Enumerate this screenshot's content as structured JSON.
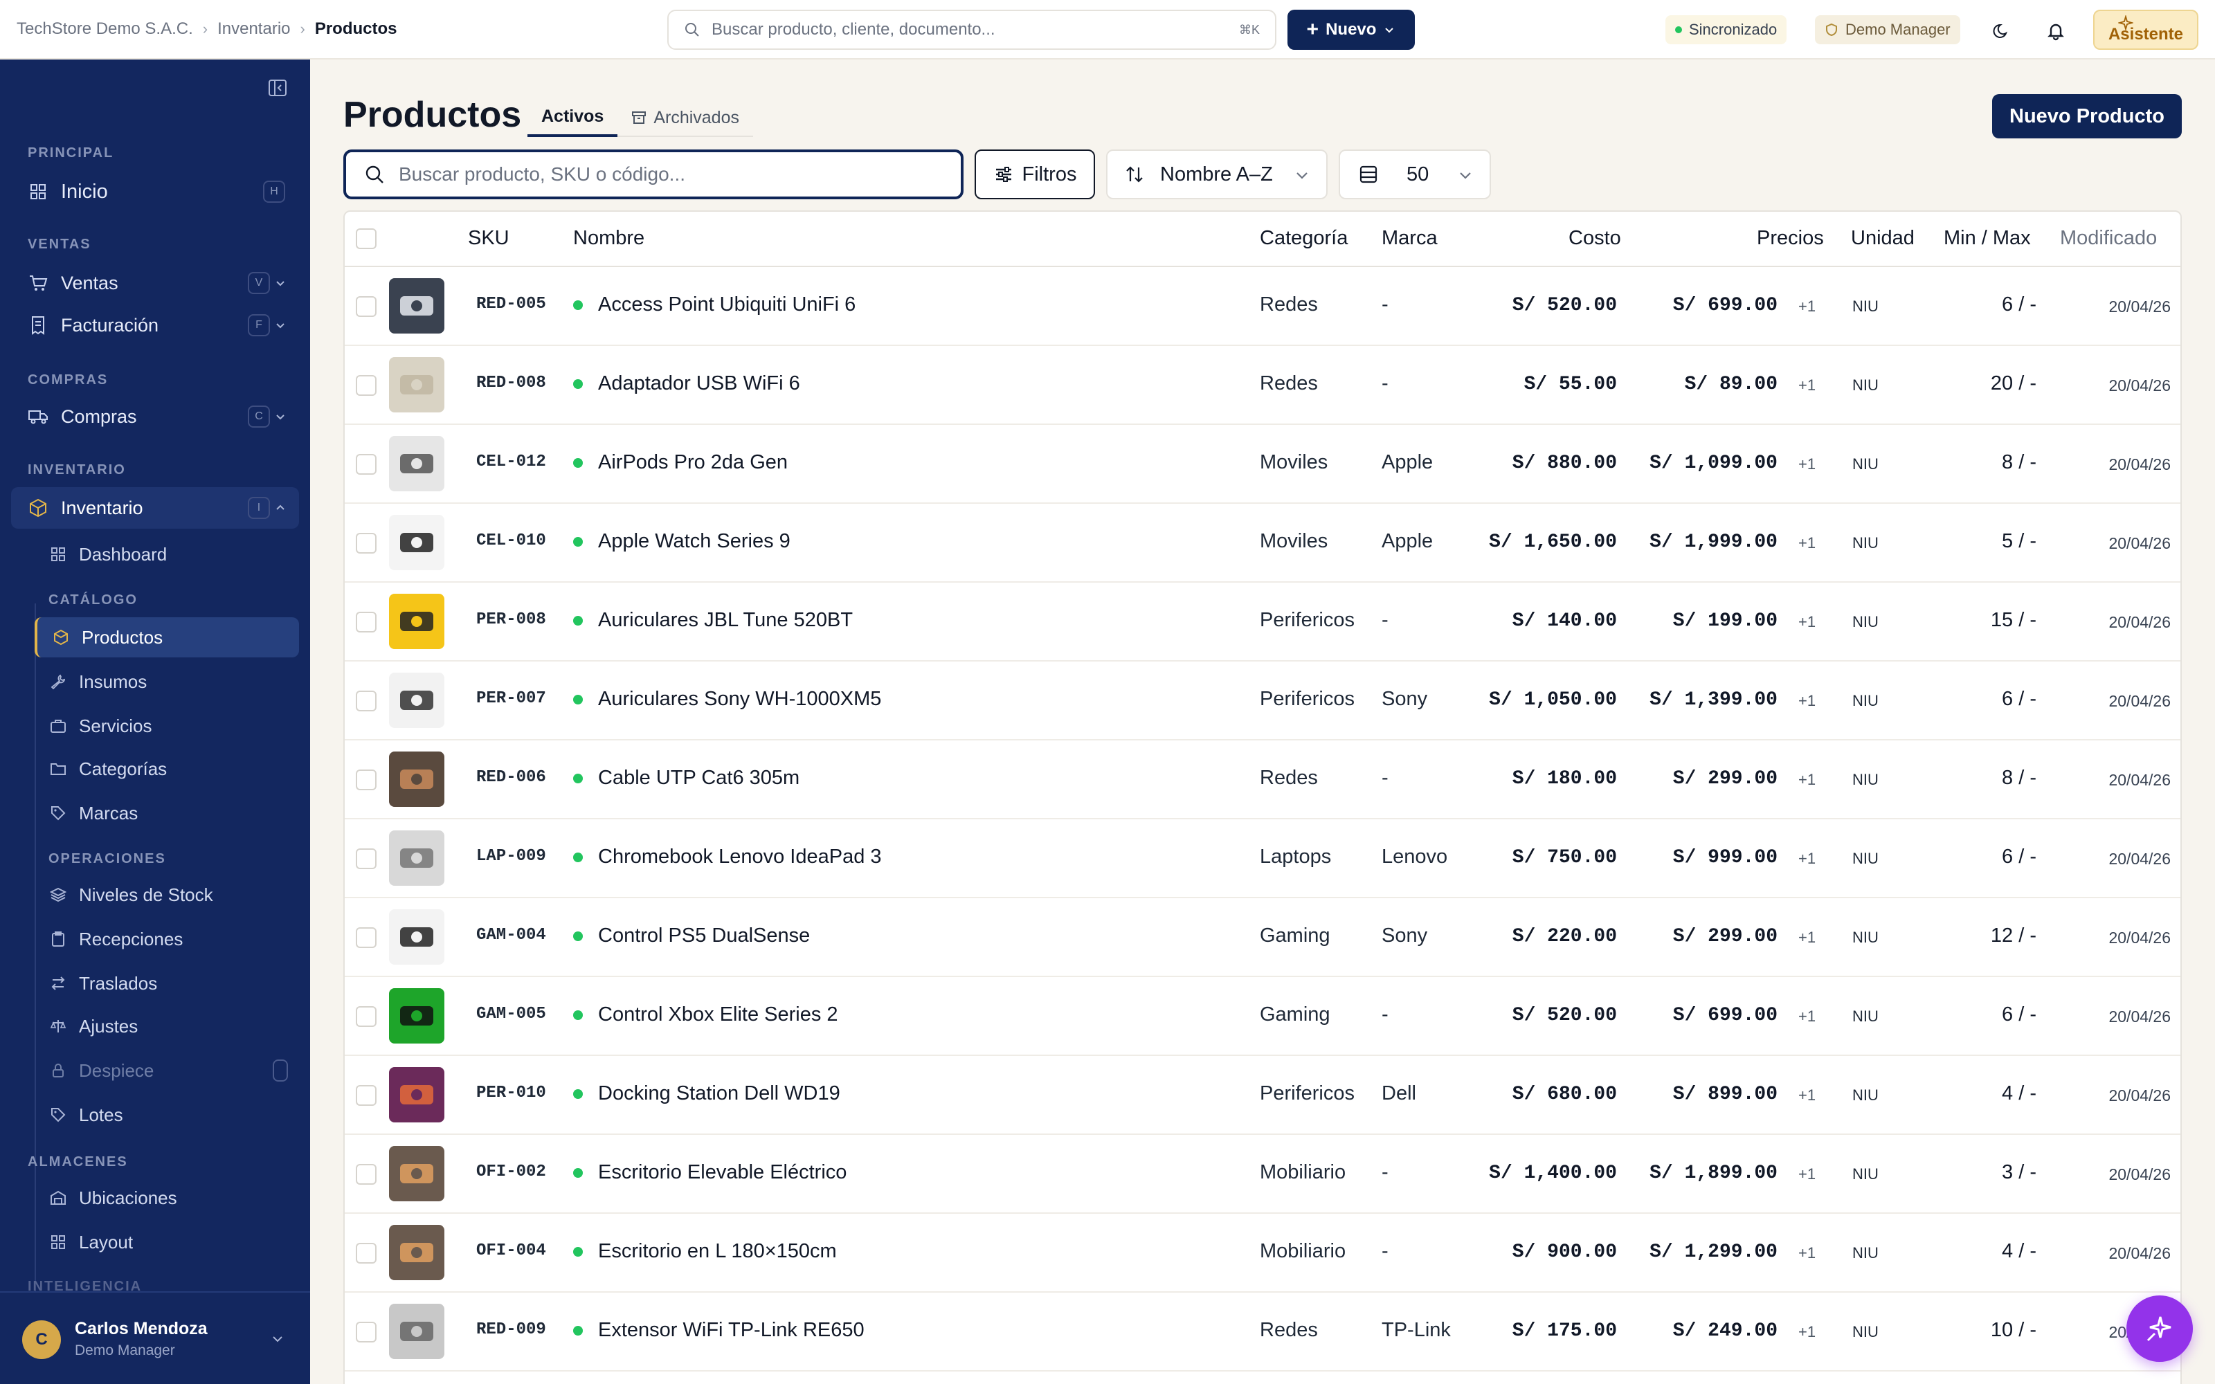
{
  "topbar": {
    "breadcrumb": [
      "TechStore Demo S.A.C.",
      "Inventario",
      "Productos"
    ],
    "search_placeholder": "Buscar producto, cliente, documento...",
    "search_shortcut": "⌘K",
    "new_label": "Nuevo",
    "sync_label": "Sincronizado",
    "role_label": "Demo Manager",
    "assistant_label": "Asistente"
  },
  "sidebar": {
    "sections": {
      "principal": "PRINCIPAL",
      "ventas": "VENTAS",
      "compras": "COMPRAS",
      "inventario": "INVENTARIO",
      "almacenes": "ALMACENES",
      "inteligencia": "INTELIGENCIA"
    },
    "items": {
      "inicio": {
        "label": "Inicio",
        "key": "H"
      },
      "ventas": {
        "label": "Ventas",
        "key": "V"
      },
      "facturacion": {
        "label": "Facturación",
        "key": "F"
      },
      "compras": {
        "label": "Compras",
        "key": "C"
      },
      "inventario": {
        "label": "Inventario",
        "key": "I"
      }
    },
    "subsections": {
      "catalogo": "CATÁLOGO",
      "operaciones": "OPERACIONES"
    },
    "sub": {
      "dashboard": "Dashboard",
      "productos": "Productos",
      "insumos": "Insumos",
      "servicios": "Servicios",
      "categorias": "Categorías",
      "marcas": "Marcas",
      "niveles": "Niveles de Stock",
      "recepciones": "Recepciones",
      "traslados": "Traslados",
      "ajustes": "Ajustes",
      "despiece": "Despiece",
      "lotes": "Lotes",
      "ubicaciones": "Ubicaciones",
      "layout": "Layout"
    },
    "user": {
      "initial": "C",
      "name": "Carlos Mendoza",
      "role": "Demo Manager"
    }
  },
  "main": {
    "title": "Productos",
    "tabs": [
      "Activos",
      "Archivados"
    ],
    "new_product_label": "Nuevo Producto",
    "search_placeholder": "Buscar producto, SKU o código...",
    "filter_label": "Filtros",
    "sort_value": "Nombre A–Z",
    "page_size": "50",
    "columns": {
      "sku": "SKU",
      "name": "Nombre",
      "category": "Categoría",
      "brand": "Marca",
      "cost": "Costo",
      "prices": "Precios",
      "unit": "Unidad",
      "minmax": "Min / Max",
      "modified": "Modificado"
    }
  },
  "rows": [
    {
      "sku": "RED-005",
      "name": "Access Point Ubiquiti UniFi 6",
      "category": "Redes",
      "brand": "-",
      "cost": "S/ 520.00",
      "price": "S/ 699.00",
      "extra": "+1",
      "unit": "NIU",
      "minmax": "6 / -",
      "modified": "20/04/26"
    },
    {
      "sku": "RED-008",
      "name": "Adaptador USB WiFi 6",
      "category": "Redes",
      "brand": "-",
      "cost": "S/ 55.00",
      "price": "S/ 89.00",
      "extra": "+1",
      "unit": "NIU",
      "minmax": "20 / -",
      "modified": "20/04/26"
    },
    {
      "sku": "CEL-012",
      "name": "AirPods Pro 2da Gen",
      "category": "Moviles",
      "brand": "Apple",
      "cost": "S/ 880.00",
      "price": "S/ 1,099.00",
      "extra": "+1",
      "unit": "NIU",
      "minmax": "8 / -",
      "modified": "20/04/26"
    },
    {
      "sku": "CEL-010",
      "name": "Apple Watch Series 9",
      "category": "Moviles",
      "brand": "Apple",
      "cost": "S/ 1,650.00",
      "price": "S/ 1,999.00",
      "extra": "+1",
      "unit": "NIU",
      "minmax": "5 / -",
      "modified": "20/04/26"
    },
    {
      "sku": "PER-008",
      "name": "Auriculares JBL Tune 520BT",
      "category": "Perifericos",
      "brand": "-",
      "cost": "S/ 140.00",
      "price": "S/ 199.00",
      "extra": "+1",
      "unit": "NIU",
      "minmax": "15 / -",
      "modified": "20/04/26"
    },
    {
      "sku": "PER-007",
      "name": "Auriculares Sony WH-1000XM5",
      "category": "Perifericos",
      "brand": "Sony",
      "cost": "S/ 1,050.00",
      "price": "S/ 1,399.00",
      "extra": "+1",
      "unit": "NIU",
      "minmax": "6 / -",
      "modified": "20/04/26"
    },
    {
      "sku": "RED-006",
      "name": "Cable UTP Cat6 305m",
      "category": "Redes",
      "brand": "-",
      "cost": "S/ 180.00",
      "price": "S/ 299.00",
      "extra": "+1",
      "unit": "NIU",
      "minmax": "8 / -",
      "modified": "20/04/26"
    },
    {
      "sku": "LAP-009",
      "name": "Chromebook Lenovo IdeaPad 3",
      "category": "Laptops",
      "brand": "Lenovo",
      "cost": "S/ 750.00",
      "price": "S/ 999.00",
      "extra": "+1",
      "unit": "NIU",
      "minmax": "6 / -",
      "modified": "20/04/26"
    },
    {
      "sku": "GAM-004",
      "name": "Control PS5 DualSense",
      "category": "Gaming",
      "brand": "Sony",
      "cost": "S/ 220.00",
      "price": "S/ 299.00",
      "extra": "+1",
      "unit": "NIU",
      "minmax": "12 / -",
      "modified": "20/04/26"
    },
    {
      "sku": "GAM-005",
      "name": "Control Xbox Elite Series 2",
      "category": "Gaming",
      "brand": "-",
      "cost": "S/ 520.00",
      "price": "S/ 699.00",
      "extra": "+1",
      "unit": "NIU",
      "minmax": "6 / -",
      "modified": "20/04/26"
    },
    {
      "sku": "PER-010",
      "name": "Docking Station Dell WD19",
      "category": "Perifericos",
      "brand": "Dell",
      "cost": "S/ 680.00",
      "price": "S/ 899.00",
      "extra": "+1",
      "unit": "NIU",
      "minmax": "4 / -",
      "modified": "20/04/26"
    },
    {
      "sku": "OFI-002",
      "name": "Escritorio Elevable Eléctrico",
      "category": "Mobiliario",
      "brand": "-",
      "cost": "S/ 1,400.00",
      "price": "S/ 1,899.00",
      "extra": "+1",
      "unit": "NIU",
      "minmax": "3 / -",
      "modified": "20/04/26"
    },
    {
      "sku": "OFI-004",
      "name": "Escritorio en L 180×150cm",
      "category": "Mobiliario",
      "brand": "-",
      "cost": "S/ 900.00",
      "price": "S/ 1,299.00",
      "extra": "+1",
      "unit": "NIU",
      "minmax": "4 / -",
      "modified": "20/04/26"
    },
    {
      "sku": "RED-009",
      "name": "Extensor WiFi TP-Link RE650",
      "category": "Redes",
      "brand": "TP-Link",
      "cost": "S/ 175.00",
      "price": "S/ 249.00",
      "extra": "+1",
      "unit": "NIU",
      "minmax": "10 / -",
      "modified": "20/04/26"
    }
  ]
}
